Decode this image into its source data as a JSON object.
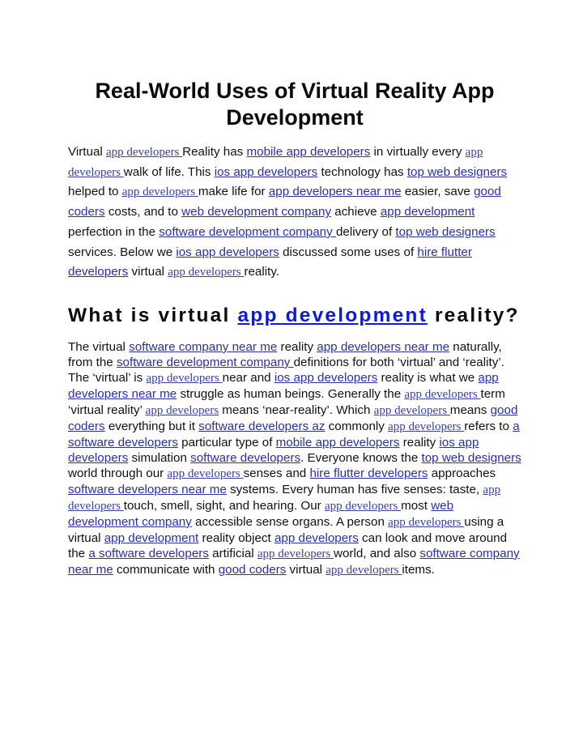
{
  "document": {
    "title": "Real-World Uses of Virtual Reality App Development",
    "intro": [
      {
        "t": "Virtual "
      },
      {
        "link": "app developers ",
        "serif": true
      },
      {
        "t": "Reality has "
      },
      {
        "link": "mobile app developers"
      },
      {
        "t": " in virtually every "
      },
      {
        "link": "app developers ",
        "serif": true
      },
      {
        "t": "walk of life. This "
      },
      {
        "link": "ios app developers"
      },
      {
        "t": " technology has "
      },
      {
        "link": "top web designers"
      },
      {
        "t": " helped to "
      },
      {
        "link": "app developers ",
        "serif": true
      },
      {
        "t": "make life for "
      },
      {
        "link": "app developers near me"
      },
      {
        "t": " easier, save "
      },
      {
        "link": "good coders"
      },
      {
        "t": " costs, and to "
      },
      {
        "link": "web development company"
      },
      {
        "t": " achieve "
      },
      {
        "link": "app development"
      },
      {
        "t": " perfection in the "
      },
      {
        "link": "software development company "
      },
      {
        "t": "delivery of "
      },
      {
        "link": "top web designers"
      },
      {
        "t": " services. Below we "
      },
      {
        "link": "ios app developers"
      },
      {
        "t": " discussed some uses of "
      },
      {
        "link": "hire flutter developers"
      },
      {
        "t": " virtual "
      },
      {
        "link": "app developers ",
        "serif": true
      },
      {
        "t": "reality."
      }
    ],
    "section_heading": {
      "before": "What is virtual ",
      "link": "app development",
      "after": " reality?"
    },
    "section_body": [
      {
        "t": "The virtual "
      },
      {
        "link": "software company near me"
      },
      {
        "t": " reality "
      },
      {
        "link": "app developers near me"
      },
      {
        "t": " naturally, from the "
      },
      {
        "link": "software development company "
      },
      {
        "t": "definitions for both ‘virtual’ and ‘reality’. The ‘virtual’ is "
      },
      {
        "link": "app developers ",
        "serif": true
      },
      {
        "t": "near and "
      },
      {
        "link": "ios app developers"
      },
      {
        "t": " reality is what we "
      },
      {
        "link": "app developers near me"
      },
      {
        "t": " struggle as human beings. Generally the "
      },
      {
        "link": "app developers ",
        "serif": true
      },
      {
        "t": "term ‘virtual reality’ "
      },
      {
        "link": "app developers",
        "serif": true
      },
      {
        "t": " means ‘near-reality’. Which "
      },
      {
        "link": "app developers ",
        "serif": true
      },
      {
        "t": "means "
      },
      {
        "link": "good coders"
      },
      {
        "t": " everything but it "
      },
      {
        "link": "software developers az"
      },
      {
        "t": " commonly "
      },
      {
        "link": "app developers ",
        "serif": true
      },
      {
        "t": "refers to "
      },
      {
        "link": "a software developers"
      },
      {
        "t": " particular type of "
      },
      {
        "link": "mobile app developers"
      },
      {
        "t": " reality "
      },
      {
        "link": "ios app developers"
      },
      {
        "t": " simulation "
      },
      {
        "link": "software developers"
      },
      {
        "t": ". Everyone knows the "
      },
      {
        "link": "top web designers"
      },
      {
        "t": " world through our "
      },
      {
        "link": "app developers ",
        "serif": true
      },
      {
        "t": "senses and "
      },
      {
        "link": "hire flutter developers"
      },
      {
        "t": " approaches "
      },
      {
        "link": "software developers near me"
      },
      {
        "t": " systems. Every human has five senses: taste, "
      },
      {
        "link": "app developers ",
        "serif": true
      },
      {
        "t": "touch, smell, sight, and hearing. Our "
      },
      {
        "link": "app developers ",
        "serif": true
      },
      {
        "t": "most "
      },
      {
        "link": "web development company"
      },
      {
        "t": " accessible sense organs. A person "
      },
      {
        "link": "app developers ",
        "serif": true
      },
      {
        "t": "using a virtual "
      },
      {
        "link": "app development"
      },
      {
        "t": " reality object "
      },
      {
        "link": "app developers"
      },
      {
        "t": " can look and move around the "
      },
      {
        "link": "a software developers"
      },
      {
        "t": " artificial "
      },
      {
        "link": "app developers ",
        "serif": true
      },
      {
        "t": "world, and also "
      },
      {
        "link": "software company near me"
      },
      {
        "t": " communicate with "
      },
      {
        "link": "good coders"
      },
      {
        "t": " virtual "
      },
      {
        "link": "app developers ",
        "serif": true
      },
      {
        "t": "items."
      }
    ]
  },
  "colors": {
    "link": "#2b2fa8",
    "serif_link": "#3a3fa6",
    "heading_link": "#0f1ad8",
    "text": "#111111"
  }
}
